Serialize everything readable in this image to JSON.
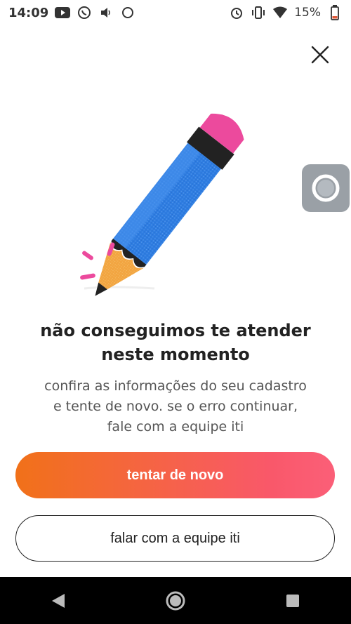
{
  "status_bar": {
    "time": "14:09",
    "battery_percent": "15%",
    "left_icons": [
      "youtube-icon",
      "whatsapp-icon",
      "volume-icon",
      "circle-icon"
    ],
    "right_icons": [
      "alarm-icon",
      "vibrate-icon",
      "wifi-icon",
      "battery-icon"
    ]
  },
  "dialog": {
    "title": "não conseguimos te atender neste momento",
    "description": "confira as informações do seu cadastro e tente de novo. se o erro continuar, fale com a equipe iti",
    "primary_button": "tentar de novo",
    "secondary_button": "falar com a equipe iti"
  },
  "colors": {
    "gradient_start": "#f17119",
    "gradient_end": "#fb5f78",
    "pencil_blue": "#2f7de1",
    "eraser_pink": "#ec4a9d",
    "wood_orange": "#f2a541"
  },
  "navigation": [
    "back-icon",
    "home-icon",
    "recents-icon"
  ]
}
